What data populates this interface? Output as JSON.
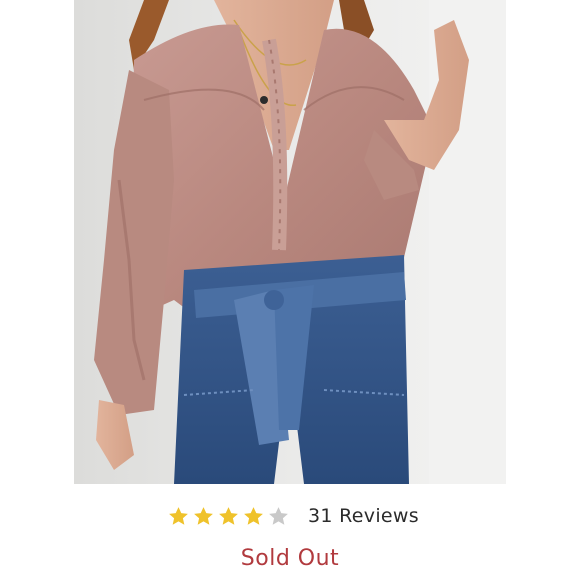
{
  "product": {
    "image_alt_icon": "product-photo"
  },
  "rating": {
    "value": 4,
    "max": 5,
    "filled_color": "#EFC22B",
    "empty_color": "#C9C9C9",
    "reviews_label": "31 Reviews"
  },
  "status": {
    "label": "Sold Out",
    "color": "#B13A3E"
  }
}
